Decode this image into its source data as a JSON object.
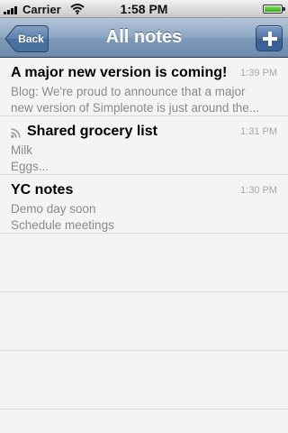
{
  "status_bar": {
    "carrier": "Carrier",
    "time": "1:58 PM",
    "battery_level": 1.0,
    "icons": [
      "signal-icon",
      "wifi-icon",
      "battery-icon"
    ]
  },
  "nav": {
    "back_label": "Back",
    "title": "All notes",
    "add_icon": "plus-icon"
  },
  "colors": {
    "nav_bar": "#7e9ab9",
    "title_text": "#ffffff",
    "snippet_text": "#8a8a8a",
    "time_text": "#a8a8a8"
  },
  "notes": [
    {
      "title": "A major new version is coming!",
      "time": "1:39 PM",
      "lines": [
        "Blog:  We're proud to announce that a major",
        "new version of Simplenote is just around the..."
      ]
    },
    {
      "title": "Shared grocery list",
      "time": "1:31 PM",
      "icon": "shared-feed-icon",
      "lines": [
        "Milk",
        "Eggs..."
      ]
    },
    {
      "title": "YC notes",
      "time": "1:30 PM",
      "lines": [
        "Demo day soon",
        "Schedule meetings"
      ]
    }
  ]
}
